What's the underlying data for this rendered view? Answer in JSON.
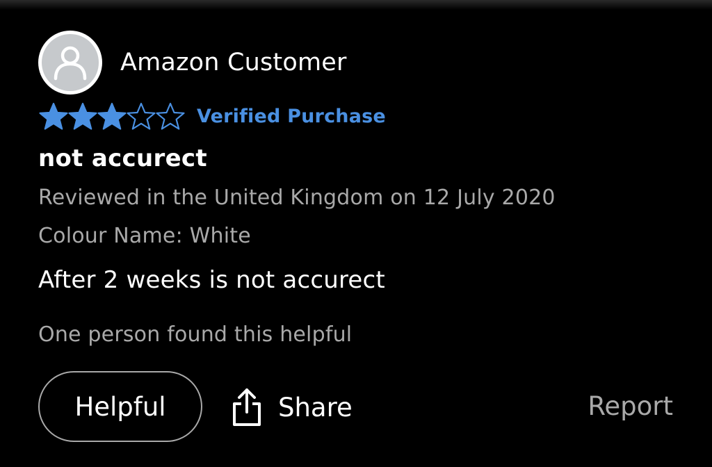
{
  "review": {
    "reviewer_name": "Amazon Customer",
    "rating": 3,
    "rating_max": 5,
    "verified_label": "Verified Purchase",
    "title": "not accurect",
    "date_line": "Reviewed in the United Kingdom on 12 July 2020",
    "colour_line": "Colour Name: White",
    "body": "After 2 weeks is not accurect",
    "helpful_count_text": "One person found this helpful"
  },
  "actions": {
    "helpful_label": "Helpful",
    "share_label": "Share",
    "report_label": "Report"
  },
  "icons": {
    "avatar": "person-icon",
    "share": "share-icon",
    "star_filled": "star-filled-icon",
    "star_empty": "star-outline-icon"
  },
  "colors": {
    "background": "#000000",
    "star": "#4a90e2",
    "verified": "#4a90e2",
    "muted_text": "#a9a9a9",
    "avatar_bg": "#c6c9cc"
  }
}
